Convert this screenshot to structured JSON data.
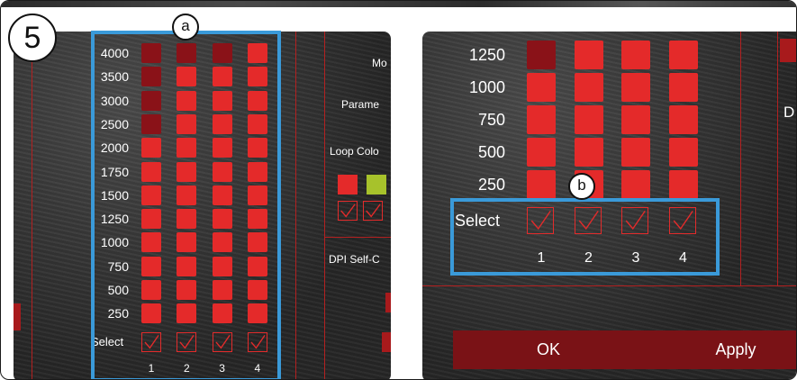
{
  "step": "5",
  "callouts": {
    "a": "a",
    "b": "b"
  },
  "colors": {
    "active": "#e42a2a",
    "inactive": "#8a1218",
    "highlight": "#3a9ad9",
    "lime": "#a7c22b"
  },
  "left": {
    "dpi_labels": [
      "4000",
      "3500",
      "3000",
      "2500",
      "2000",
      "1750",
      "1500",
      "1250",
      "1000",
      "750",
      "500",
      "250"
    ],
    "select_label": "Select",
    "columns": [
      "1",
      "2",
      "3",
      "4"
    ],
    "levels": [
      8,
      11,
      11,
      12
    ],
    "side_text": {
      "mode": "Mo",
      "params": "Parame",
      "loop_color": "Loop Colo",
      "dpi_self": "DPI Self-C"
    }
  },
  "right": {
    "dpi_labels": [
      "1250",
      "1000",
      "750",
      "500",
      "250"
    ],
    "select_label": "Select",
    "columns": [
      "1",
      "2",
      "3",
      "4"
    ],
    "levels": [
      4,
      5,
      5,
      5
    ],
    "side_text": {
      "d": "D"
    },
    "ok_label": "OK",
    "apply_label": "Apply"
  }
}
